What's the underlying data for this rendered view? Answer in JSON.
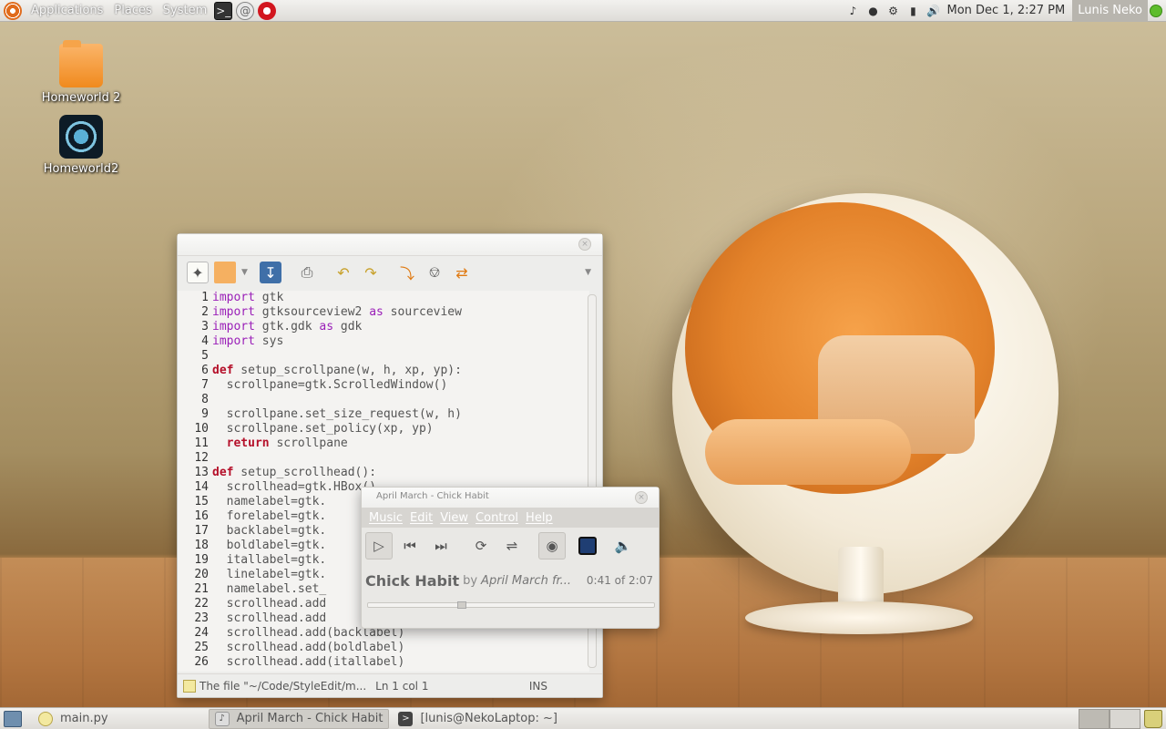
{
  "top_panel": {
    "menus": [
      "Applications",
      "Places",
      "System"
    ],
    "clock": "Mon Dec  1,  2:27 PM",
    "user": "Lunis Neko"
  },
  "desktop_icons": [
    {
      "label": "Homeworld 2"
    },
    {
      "label": "Homeworld2"
    }
  ],
  "editor": {
    "lines": [
      {
        "n": "1",
        "parts": [
          [
            "kw-purple",
            "import"
          ],
          [
            "txt",
            " gtk"
          ]
        ]
      },
      {
        "n": "2",
        "parts": [
          [
            "kw-purple",
            "import"
          ],
          [
            "txt",
            " gtksourceview2 "
          ],
          [
            "kw-purple",
            "as"
          ],
          [
            "txt",
            " sourceview"
          ]
        ]
      },
      {
        "n": "3",
        "parts": [
          [
            "kw-purple",
            "import"
          ],
          [
            "txt",
            " gtk.gdk "
          ],
          [
            "kw-purple",
            "as"
          ],
          [
            "txt",
            " gdk"
          ]
        ]
      },
      {
        "n": "4",
        "parts": [
          [
            "kw-purple",
            "import"
          ],
          [
            "txt",
            " sys"
          ]
        ]
      },
      {
        "n": "5",
        "parts": []
      },
      {
        "n": "6",
        "parts": [
          [
            "kw-red",
            "def"
          ],
          [
            "txt",
            " setup_scrollpane(w, h, xp, yp):"
          ]
        ]
      },
      {
        "n": "7",
        "parts": [
          [
            "txt",
            "  scrollpane=gtk.ScrolledWindow()"
          ]
        ]
      },
      {
        "n": "8",
        "parts": []
      },
      {
        "n": "9",
        "parts": [
          [
            "txt",
            "  scrollpane.set_size_request(w, h)"
          ]
        ]
      },
      {
        "n": "10",
        "parts": [
          [
            "txt",
            "  scrollpane.set_policy(xp, yp)"
          ]
        ]
      },
      {
        "n": "11",
        "parts": [
          [
            "kw-red",
            "  return"
          ],
          [
            "txt",
            " scrollpane"
          ]
        ]
      },
      {
        "n": "12",
        "parts": []
      },
      {
        "n": "13",
        "parts": [
          [
            "kw-red",
            "def"
          ],
          [
            "txt",
            " setup_scrollhead():"
          ]
        ]
      },
      {
        "n": "14",
        "parts": [
          [
            "txt",
            "  scrollhead=gtk.HBox()"
          ]
        ]
      },
      {
        "n": "15",
        "parts": [
          [
            "txt",
            "  namelabel=gtk."
          ]
        ]
      },
      {
        "n": "16",
        "parts": [
          [
            "txt",
            "  forelabel=gtk."
          ]
        ]
      },
      {
        "n": "17",
        "parts": [
          [
            "txt",
            "  backlabel=gtk."
          ]
        ]
      },
      {
        "n": "18",
        "parts": [
          [
            "txt",
            "  boldlabel=gtk."
          ]
        ]
      },
      {
        "n": "19",
        "parts": [
          [
            "txt",
            "  itallabel=gtk."
          ]
        ]
      },
      {
        "n": "20",
        "parts": [
          [
            "txt",
            "  linelabel=gtk."
          ]
        ]
      },
      {
        "n": "21",
        "parts": [
          [
            "txt",
            "  namelabel.set_"
          ]
        ]
      },
      {
        "n": "22",
        "parts": [
          [
            "txt",
            "  scrollhead.add"
          ]
        ]
      },
      {
        "n": "23",
        "parts": [
          [
            "txt",
            "  scrollhead.add"
          ]
        ]
      },
      {
        "n": "24",
        "parts": [
          [
            "txt",
            "  scrollhead.add(backlabel)"
          ]
        ]
      },
      {
        "n": "25",
        "parts": [
          [
            "txt",
            "  scrollhead.add(boldlabel)"
          ]
        ]
      },
      {
        "n": "26",
        "parts": [
          [
            "txt",
            "  scrollhead.add(itallabel)"
          ]
        ]
      }
    ],
    "status_file": "The file \"~/Code/StyleEdit/m...",
    "status_pos": "Ln 1 col 1",
    "status_mode": "INS"
  },
  "player": {
    "window_title": "April March - Chick Habit",
    "menus": [
      "Music",
      "Edit",
      "View",
      "Control",
      "Help"
    ],
    "song_title": "Chick Habit",
    "by": "by",
    "artist": "April March fr...",
    "time": "0:41 of 2:07",
    "progress": 0.32
  },
  "taskbar": {
    "tasks": [
      "main.py",
      "April March - Chick Habit",
      "[lunis@NekoLaptop: ~]"
    ]
  }
}
